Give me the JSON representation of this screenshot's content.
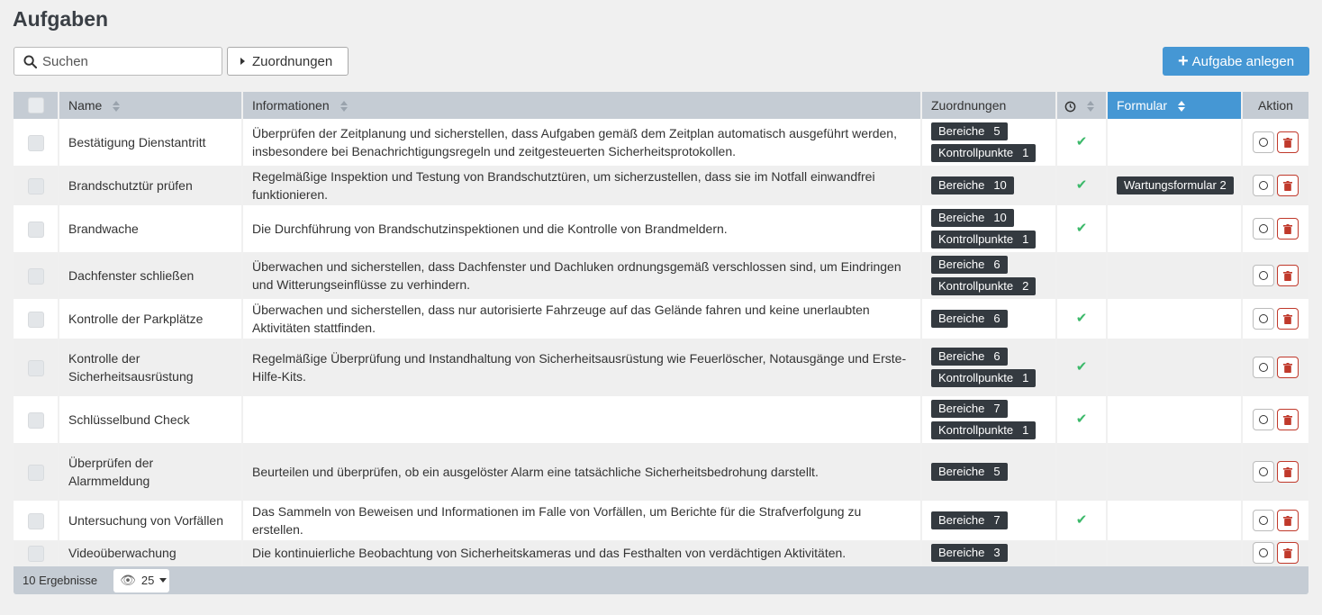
{
  "page": {
    "title": "Aufgaben"
  },
  "toolbar": {
    "search_placeholder": "Suchen",
    "assignments_label": "Zuordnungen",
    "add_label": "Aufgabe anlegen"
  },
  "table": {
    "headers": {
      "name": "Name",
      "info": "Informationen",
      "assignments": "Zuordnungen",
      "form": "Formular",
      "action": "Aktion"
    },
    "rows": [
      {
        "name": "Bestätigung Dienstantritt",
        "info": "Überprüfen der Zeitplanung und sicherstellen, dass Aufgaben gemäß dem Zeitplan automatisch ausgeführt werden, insbesondere bei Benachrichtigungsregeln und zeitgesteuerten Sicherheitsprotokollen.",
        "badges": [
          [
            "Bereiche",
            "5"
          ],
          [
            "Kontrollpunkte",
            "1"
          ]
        ],
        "scheduled": true,
        "form": "",
        "h": 52
      },
      {
        "name": "Brandschutztür prüfen",
        "info": "Regelmäßige Inspektion und Testung von Brandschutztüren, um sicherzustellen, dass sie im Notfall einwandfrei funktionieren.",
        "badges": [
          [
            "Bereiche",
            "10"
          ]
        ],
        "scheduled": true,
        "form": "Wartungsformular 2",
        "h": 44
      },
      {
        "name": "Brandwache",
        "info": "Die Durchführung von Brandschutzinspektionen und die Kontrolle von Brandmeldern.",
        "badges": [
          [
            "Bereiche",
            "10"
          ],
          [
            "Kontrollpunkte",
            "1"
          ]
        ],
        "scheduled": true,
        "form": "",
        "h": 52
      },
      {
        "name": "Dachfenster schließen",
        "info": "Überwachen und sicherstellen, dass Dachfenster und Dachluken ordnungsgemäß verschlossen sind, um Eindringen und Witterungseinflüsse zu verhindern.",
        "badges": [
          [
            "Bereiche",
            "6"
          ],
          [
            "Kontrollpunkte",
            "2"
          ]
        ],
        "scheduled": false,
        "form": "",
        "h": 52
      },
      {
        "name": "Kontrolle der Parkplätze",
        "info": "Überwachen und sicherstellen, dass nur autorisierte Fahrzeuge auf das Gelände fahren und keine unerlaubten Aktivitäten stattfinden.",
        "badges": [
          [
            "Bereiche",
            "6"
          ]
        ],
        "scheduled": true,
        "form": "",
        "h": 44
      },
      {
        "name": "Kontrolle der Sicherheitsausrüstung",
        "info": "Regelmäßige Überprüfung und Instandhaltung von Sicherheitsausrüstung wie Feuerlöscher, Notausgänge und Erste-Hilfe-Kits.",
        "badges": [
          [
            "Bereiche",
            "6"
          ],
          [
            "Kontrollpunkte",
            "1"
          ]
        ],
        "scheduled": true,
        "form": "",
        "h": 64
      },
      {
        "name": "Schlüsselbund Check",
        "info": "",
        "badges": [
          [
            "Bereiche",
            "7"
          ],
          [
            "Kontrollpunkte",
            "1"
          ]
        ],
        "scheduled": true,
        "form": "",
        "h": 52
      },
      {
        "name": "Überprüfen der Alarmmeldung",
        "info": "Beurteilen und überprüfen, ob ein ausgelöster Alarm eine tatsächliche Sicherheitsbedrohung darstellt.",
        "badges": [
          [
            "Bereiche",
            "5"
          ]
        ],
        "scheduled": false,
        "form": "",
        "h": 64
      },
      {
        "name": "Untersuchung von Vorfällen",
        "info": "Das Sammeln von Beweisen und Informationen im Falle von Vorfällen, um Berichte für die Strafverfolgung zu erstellen.",
        "badges": [
          [
            "Bereiche",
            "7"
          ]
        ],
        "scheduled": true,
        "form": "",
        "h": 44
      },
      {
        "name": "Videoüberwachung",
        "info": "Die kontinuierliche Beobachtung von Sicherheitskameras und das Festhalten von verdächtigen Aktivitäten.",
        "badges": [
          [
            "Bereiche",
            "3"
          ]
        ],
        "scheduled": false,
        "form": "",
        "h": 28
      }
    ]
  },
  "footer": {
    "results": "10 Ergebnisse",
    "per_page": "25"
  },
  "colors": {
    "primary": "#4597d4",
    "header": "#c5ccd4",
    "badge": "#343a40",
    "check": "#3cb96a",
    "danger": "#c0392b"
  }
}
